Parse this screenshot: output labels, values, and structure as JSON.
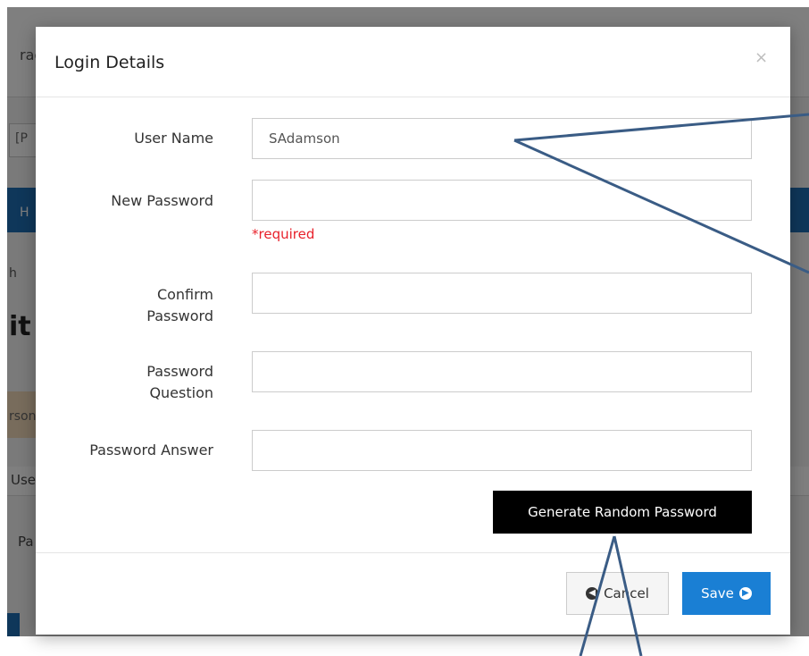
{
  "background": {
    "topbar_fragment": "rac",
    "select_fragment": "[P",
    "navbar_fragment": "H",
    "breadcrumb_fragment": "h",
    "heading_fragment": "it",
    "orange_fragment": "rson",
    "row1_fragment": "Use",
    "row2_fragment": "Pa",
    "stars_fragment": "**"
  },
  "modal": {
    "title": "Login Details",
    "close_glyph": "×",
    "fields": {
      "user_name": {
        "label": "User Name",
        "value": "SAdamson"
      },
      "new_password": {
        "label": "New Password",
        "value": "",
        "required_text": "*required"
      },
      "confirm_password": {
        "label_line1": "Confirm",
        "label_line2": "Password",
        "value": ""
      },
      "password_question": {
        "label_line1": "Password",
        "label_line2": "Question",
        "value": ""
      },
      "password_answer": {
        "label": "Password Answer",
        "value": ""
      }
    },
    "generate_button": "Generate Random Password",
    "cancel_button": "Cancel",
    "save_button": "Save"
  },
  "colors": {
    "accent_blue": "#1a7fd4",
    "required_red": "#e8202a",
    "annotation_line": "#3a5c85"
  },
  "icons": {
    "cancel": "arrow-circle-left-icon",
    "save": "arrow-circle-right-icon",
    "close": "close-icon"
  }
}
